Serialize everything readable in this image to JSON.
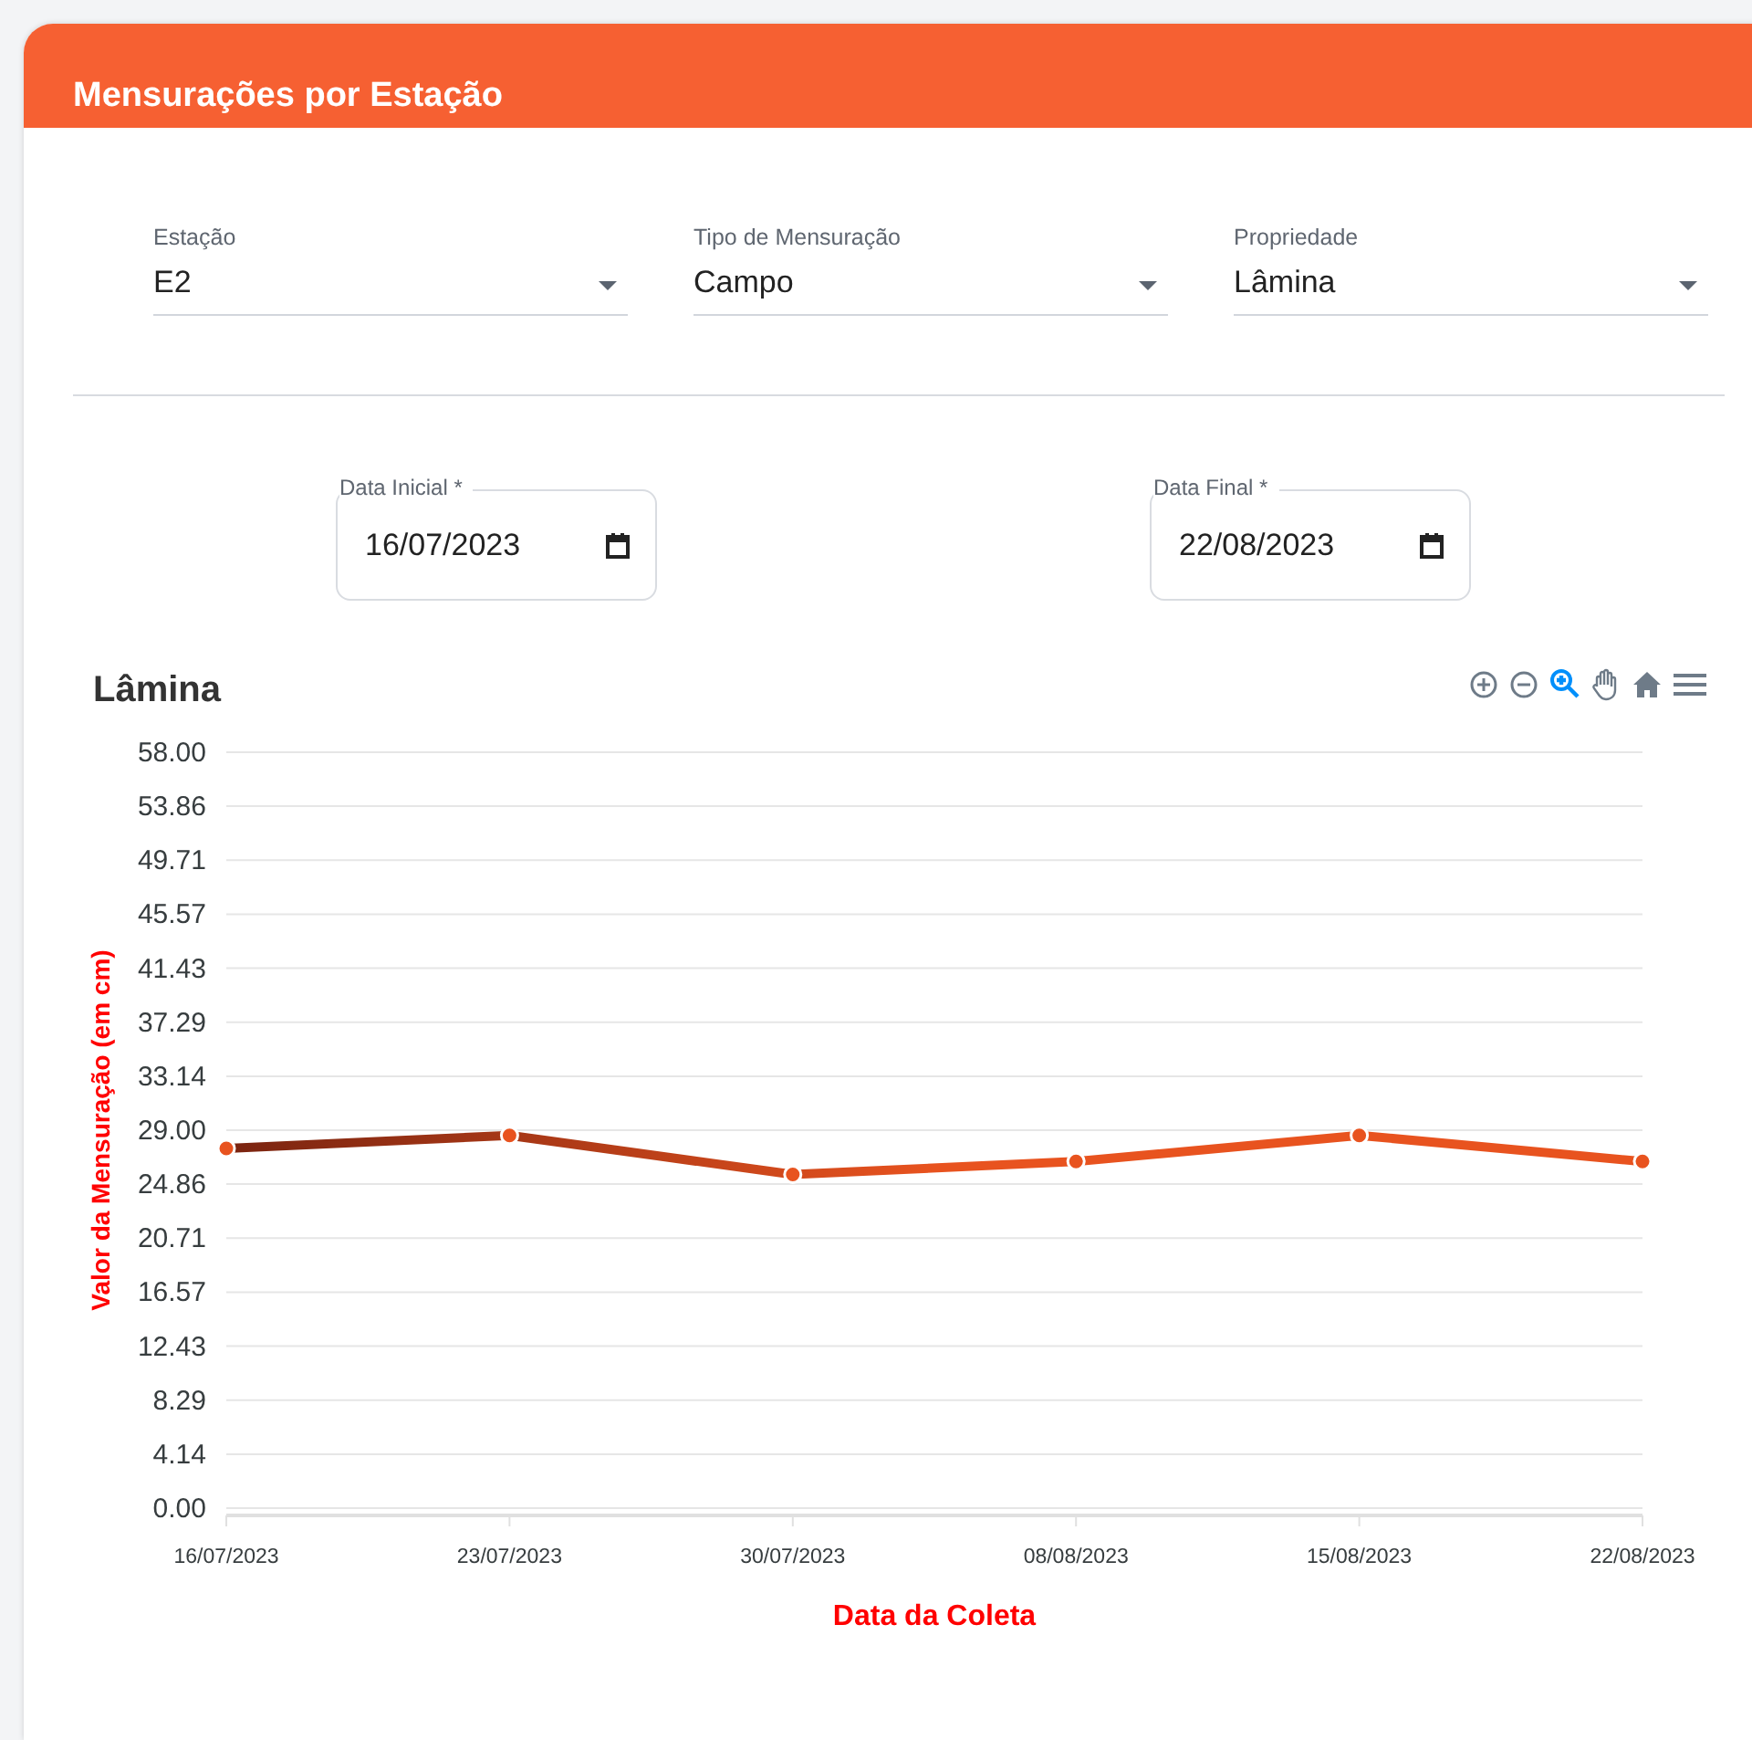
{
  "card": {
    "title": "Mensurações por Estação"
  },
  "selects": [
    {
      "label": "Estação",
      "value": "E2"
    },
    {
      "label": "Tipo de Mensuração",
      "value": "Campo"
    },
    {
      "label": "Propriedade",
      "value": "Lâmina"
    }
  ],
  "date_fields": [
    {
      "label": "Data Inicial *",
      "value": "16/07/2023"
    },
    {
      "label": "Data Final *",
      "value": "22/08/2023"
    }
  ],
  "chart": {
    "title": "Lâmina",
    "chart_data": {
      "type": "line",
      "xlabel": "Data da Coleta",
      "ylabel": "Valor da Mensuração (em cm)",
      "categories": [
        "16/07/2023",
        "23/07/2023",
        "30/07/2023",
        "08/08/2023",
        "15/08/2023",
        "22/08/2023"
      ],
      "grid": true,
      "series": [
        {
          "color": "#e8531f",
          "marker": true,
          "values": [
            27.6,
            28.6,
            25.6,
            26.6,
            28.6,
            26.6
          ]
        }
      ],
      "ylim": [
        0,
        58
      ],
      "yticks": [
        {
          "value": 0,
          "label": "0.00"
        },
        {
          "value": 4.14,
          "label": "4.14"
        },
        {
          "value": 8.29,
          "label": "8.29"
        },
        {
          "value": 12.43,
          "label": "12.43"
        },
        {
          "value": 16.57,
          "label": "16.57"
        },
        {
          "value": 20.71,
          "label": "20.71"
        },
        {
          "value": 24.86,
          "label": "24.86"
        },
        {
          "value": 29,
          "label": "29.00"
        },
        {
          "value": 33.14,
          "label": "33.14"
        },
        {
          "value": 37.29,
          "label": "37.29"
        },
        {
          "value": 41.43,
          "label": "41.43"
        },
        {
          "value": 45.57,
          "label": "45.57"
        },
        {
          "value": 49.71,
          "label": "49.71"
        },
        {
          "value": 53.86,
          "label": "53.86"
        },
        {
          "value": 58,
          "label": "58.00"
        }
      ]
    }
  }
}
